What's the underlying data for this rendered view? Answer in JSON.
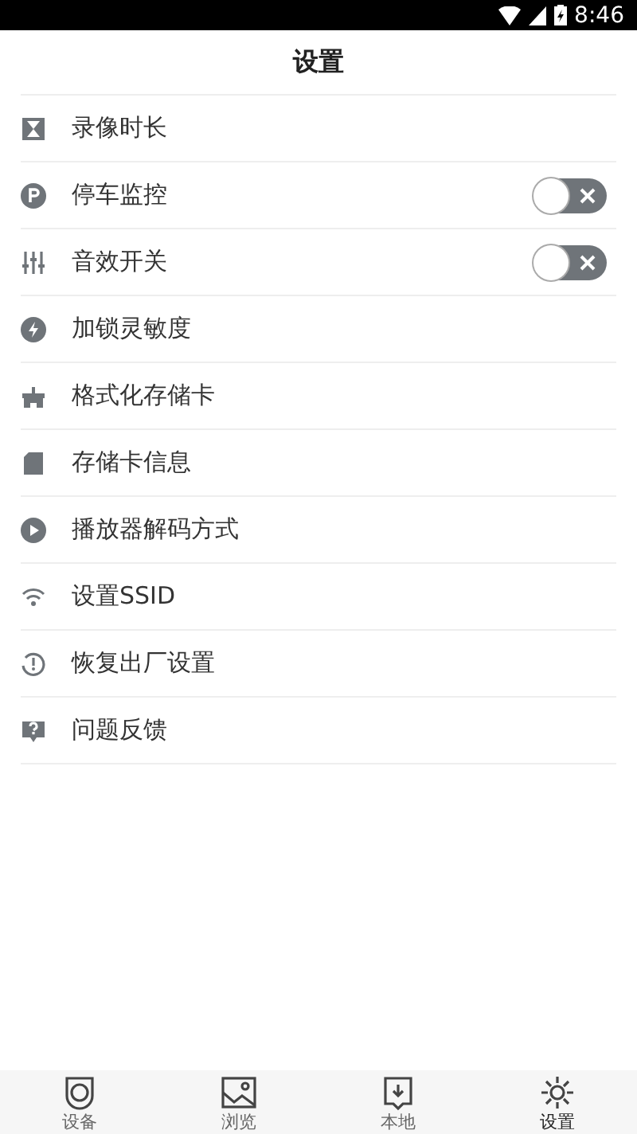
{
  "status_bar": {
    "time": "8:46"
  },
  "header": {
    "title": "设置"
  },
  "items": [
    {
      "label": "录像时长",
      "kind": "plain"
    },
    {
      "label": "停车监控",
      "kind": "toggle",
      "on": false
    },
    {
      "label": "音效开关",
      "kind": "toggle",
      "on": false
    },
    {
      "label": "加锁灵敏度",
      "kind": "plain"
    },
    {
      "label": "格式化存储卡",
      "kind": "plain"
    },
    {
      "label": "存储卡信息",
      "kind": "plain"
    },
    {
      "label": "播放器解码方式",
      "kind": "plain"
    },
    {
      "label": "设置SSID",
      "kind": "plain"
    },
    {
      "label": "恢复出厂设置",
      "kind": "plain"
    },
    {
      "label": "问题反馈",
      "kind": "plain"
    }
  ],
  "tab_bar": [
    {
      "label": "设备",
      "selected": false
    },
    {
      "label": "浏览",
      "selected": false
    },
    {
      "label": "本地",
      "selected": false
    },
    {
      "label": "设置",
      "selected": true
    }
  ]
}
